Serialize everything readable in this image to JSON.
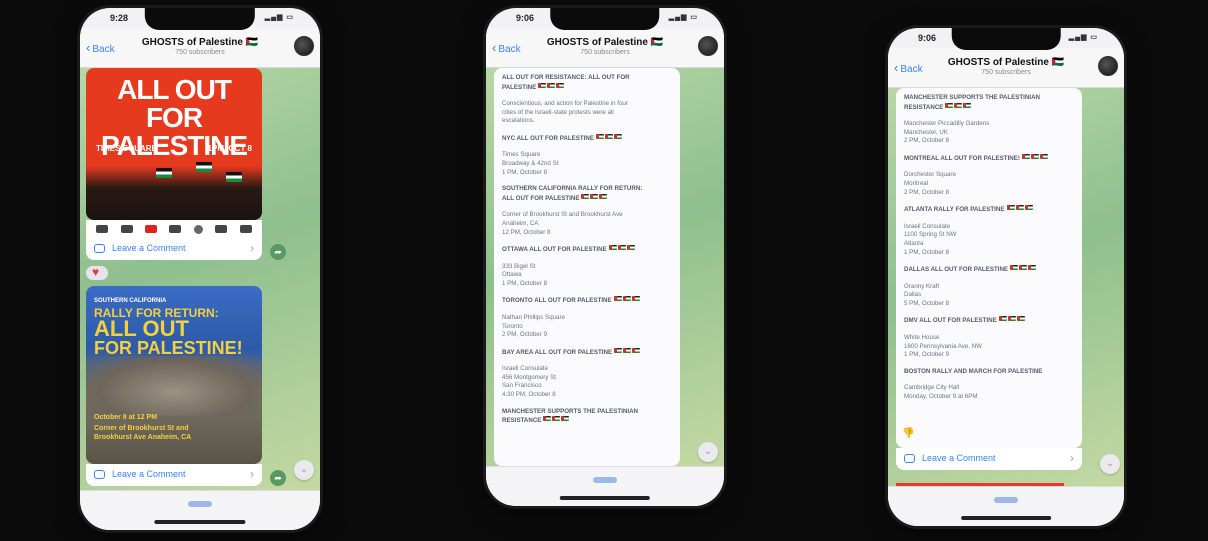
{
  "phone1": {
    "time": "9:28",
    "header": {
      "back": "Back",
      "title": "GHOSTS of Palestine 🇵🇸",
      "subtitle": "750 subscribers"
    },
    "poster1": {
      "headline": "ALL OUT FOR PALESTINE",
      "place": "TIMES SQUARE",
      "time": "1PM, OCT 8"
    },
    "comment1": "Leave a Comment",
    "poster2": {
      "kicker": "SOUTHERN CALIFORNIA",
      "line1": "RALLY FOR RETURN:",
      "line2": "ALL OUT",
      "line3": "FOR PALESTINE!",
      "when": "October 8 at 12 PM",
      "where": "Corner of Brookhurst St and Brookhurst Ave Anaheim, CA"
    },
    "comment2": "Leave a Comment"
  },
  "phone2": {
    "time": "9:06",
    "header": {
      "back": "Back",
      "title": "GHOSTS of Palestine 🇵🇸",
      "subtitle": "750 subscribers"
    },
    "lines": [
      {
        "text": "ALL OUT FOR RESISTANCE: ALL OUT FOR",
        "head": true
      },
      {
        "text": "PALESTINE",
        "head": true,
        "flags": true
      },
      {
        "gap": true
      },
      {
        "text": "Conscientious, and action for Palestine in four"
      },
      {
        "text": "cities of the Israeli-state protests were all"
      },
      {
        "text": "escalations."
      },
      {
        "gap": true
      },
      {
        "text": "NYC ALL OUT FOR PALESTINE",
        "head": true,
        "flags": true
      },
      {
        "gap": true
      },
      {
        "text": "Times Square"
      },
      {
        "text": "Broadway & 42nd St"
      },
      {
        "text": "1 PM, October 8"
      },
      {
        "gap": true
      },
      {
        "text": "SOUTHERN CALIFORNIA RALLY FOR RETURN:",
        "head": true
      },
      {
        "text": "ALL OUT FOR PALESTINE",
        "head": true,
        "flags": true
      },
      {
        "gap": true
      },
      {
        "text": "Corner of Brookhurst St and Brookhurst Ave"
      },
      {
        "text": "Anaheim, CA"
      },
      {
        "text": "12 PM, October 8"
      },
      {
        "gap": true
      },
      {
        "text": "OTTAWA ALL OUT FOR PALESTINE",
        "head": true,
        "flags": true
      },
      {
        "gap": true
      },
      {
        "text": "333 Bigel St"
      },
      {
        "text": "Ottawa"
      },
      {
        "text": "1 PM, October 8"
      },
      {
        "gap": true
      },
      {
        "text": "TORONTO ALL OUT FOR PALESTINE",
        "head": true,
        "flags": true
      },
      {
        "gap": true
      },
      {
        "text": "Nathan Phillips Square"
      },
      {
        "text": "Toronto"
      },
      {
        "text": "2 PM, October 9"
      },
      {
        "gap": true
      },
      {
        "text": "BAY AREA ALL OUT FOR PALESTINE",
        "head": true,
        "flags": true
      },
      {
        "gap": true
      },
      {
        "text": "Israeli Consulate"
      },
      {
        "text": "456 Montgomery St"
      },
      {
        "text": "San Francisco"
      },
      {
        "text": "4:30 PM, October 8"
      },
      {
        "gap": true
      },
      {
        "text": "MANCHESTER SUPPORTS THE PALESTINIAN",
        "head": true
      },
      {
        "text": "RESISTANCE",
        "head": true,
        "flags": true
      }
    ]
  },
  "phone3": {
    "time": "9:06",
    "header": {
      "back": "Back",
      "title": "GHOSTS of Palestine 🇵🇸",
      "subtitle": "750 subscribers"
    },
    "lines": [
      {
        "text": "MANCHESTER SUPPORTS THE PALESTINIAN",
        "head": true
      },
      {
        "text": "RESISTANCE",
        "head": true,
        "flags": true
      },
      {
        "gap": true
      },
      {
        "text": "Manchester Piccadilly Gardens"
      },
      {
        "text": "Manchester, UK"
      },
      {
        "text": "2 PM, October 8"
      },
      {
        "gap": true
      },
      {
        "text": "MONTREAL ALL OUT FOR PALESTINE!",
        "head": true,
        "flags": true
      },
      {
        "gap": true
      },
      {
        "text": "Dorchester Square"
      },
      {
        "text": "Montreal"
      },
      {
        "text": "2 PM, October 8"
      },
      {
        "gap": true
      },
      {
        "text": "ATLANTA RALLY FOR PALESTINE",
        "head": true,
        "flags": true
      },
      {
        "gap": true
      },
      {
        "text": "Israeli Consulate"
      },
      {
        "text": "1100 Spring St NW"
      },
      {
        "text": "Atlanta"
      },
      {
        "text": "1 PM, October 8"
      },
      {
        "gap": true
      },
      {
        "text": "DALLAS ALL OUT FOR PALESTINE",
        "head": true,
        "flags": true
      },
      {
        "gap": true
      },
      {
        "text": "Granny Kraft"
      },
      {
        "text": "Dallas"
      },
      {
        "text": "5 PM, October 8"
      },
      {
        "gap": true
      },
      {
        "text": "DMV ALL OUT FOR PALESTINE",
        "head": true,
        "flags": true
      },
      {
        "gap": true
      },
      {
        "text": "White House"
      },
      {
        "text": "1600 Pennsylvania Ave, NW"
      },
      {
        "text": "1 PM, October 9"
      },
      {
        "gap": true
      },
      {
        "text": "BOSTON RALLY AND MARCH FOR PALESTINE",
        "head": true
      },
      {
        "gap": true
      },
      {
        "text": "Cambridge City Hall"
      },
      {
        "text": "Monday, October 9 at 6PM"
      }
    ],
    "reaction": "👎",
    "comment": "Leave a Comment"
  },
  "icons": {
    "back": "chevron-left-icon",
    "comment": "comment-icon",
    "share": "share-icon",
    "scroll": "chevron-down-icon",
    "heart": "heart-icon"
  },
  "colors": {
    "accent": "#3b82f6",
    "posterRed": "#e63a1e",
    "posterYellow": "#f4d03f",
    "chatGreen": "#8fbf8e"
  }
}
